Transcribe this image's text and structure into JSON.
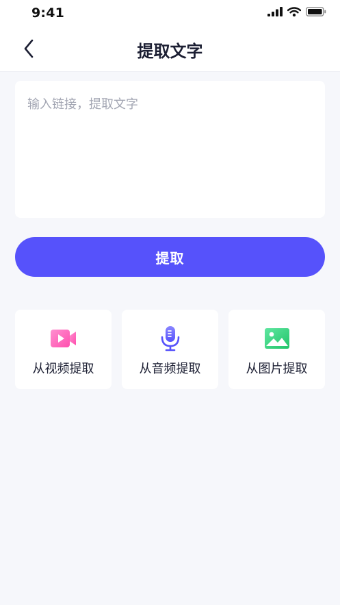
{
  "status_bar": {
    "time": "9:41"
  },
  "header": {
    "title": "提取文字",
    "back_icon": "chevron-left-icon"
  },
  "input": {
    "placeholder": "输入链接，提取文字",
    "value": ""
  },
  "primary_button": {
    "label": "提取",
    "color": "#5652fb"
  },
  "options": [
    {
      "label": "从视频提取",
      "icon": "video-camera-icon",
      "color": "#ff6fbf"
    },
    {
      "label": "从音频提取",
      "icon": "microphone-icon",
      "color": "#6a66ff"
    },
    {
      "label": "从图片提取",
      "icon": "image-icon",
      "color": "#3ad37a"
    }
  ]
}
